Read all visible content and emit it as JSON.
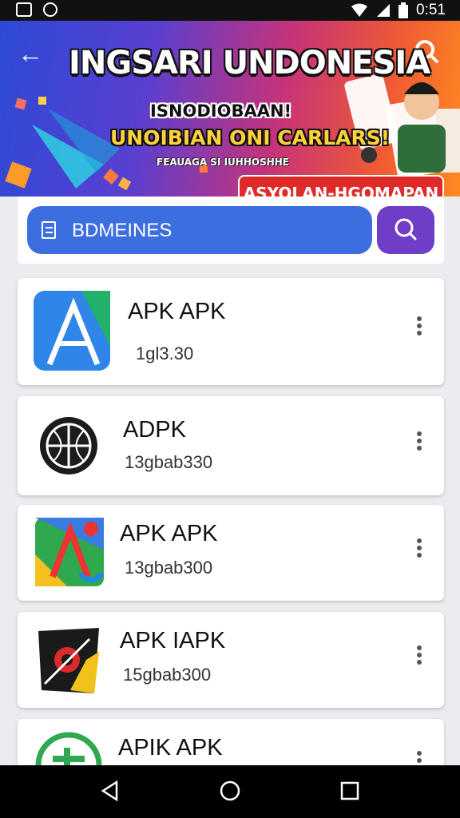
{
  "status_bar": {
    "time": "0:51",
    "icons": [
      "notification-icon",
      "sync-icon",
      "wifi-icon",
      "signal-icon",
      "battery-icon"
    ]
  },
  "banner": {
    "title": "INGSARI UNDONESIA",
    "subtitle": "ISNODIOBAAN!",
    "subtitle2": "UNOIBIAN ONI CARLARS!",
    "small_text": "FEAUAGA SI IUHHOSHHE",
    "cta": "ASYOLAN-HGOMAPAN"
  },
  "search": {
    "placeholder": "BDMEINES"
  },
  "apps": [
    {
      "name": "APK APK",
      "meta": "1gl3.30"
    },
    {
      "name": "ADPK",
      "meta": "13gbab330"
    },
    {
      "name": "APK APK",
      "meta": "13gbab300"
    },
    {
      "name": "APK IAPK",
      "meta": "15gbab300"
    },
    {
      "name": "APIK APK",
      "meta": ""
    }
  ],
  "nav": {
    "buttons": [
      "back",
      "home",
      "recents"
    ]
  },
  "colors": {
    "primary": "#3c6ee0",
    "search_button": "#6e3fc6",
    "cta": "#e02a2a"
  }
}
